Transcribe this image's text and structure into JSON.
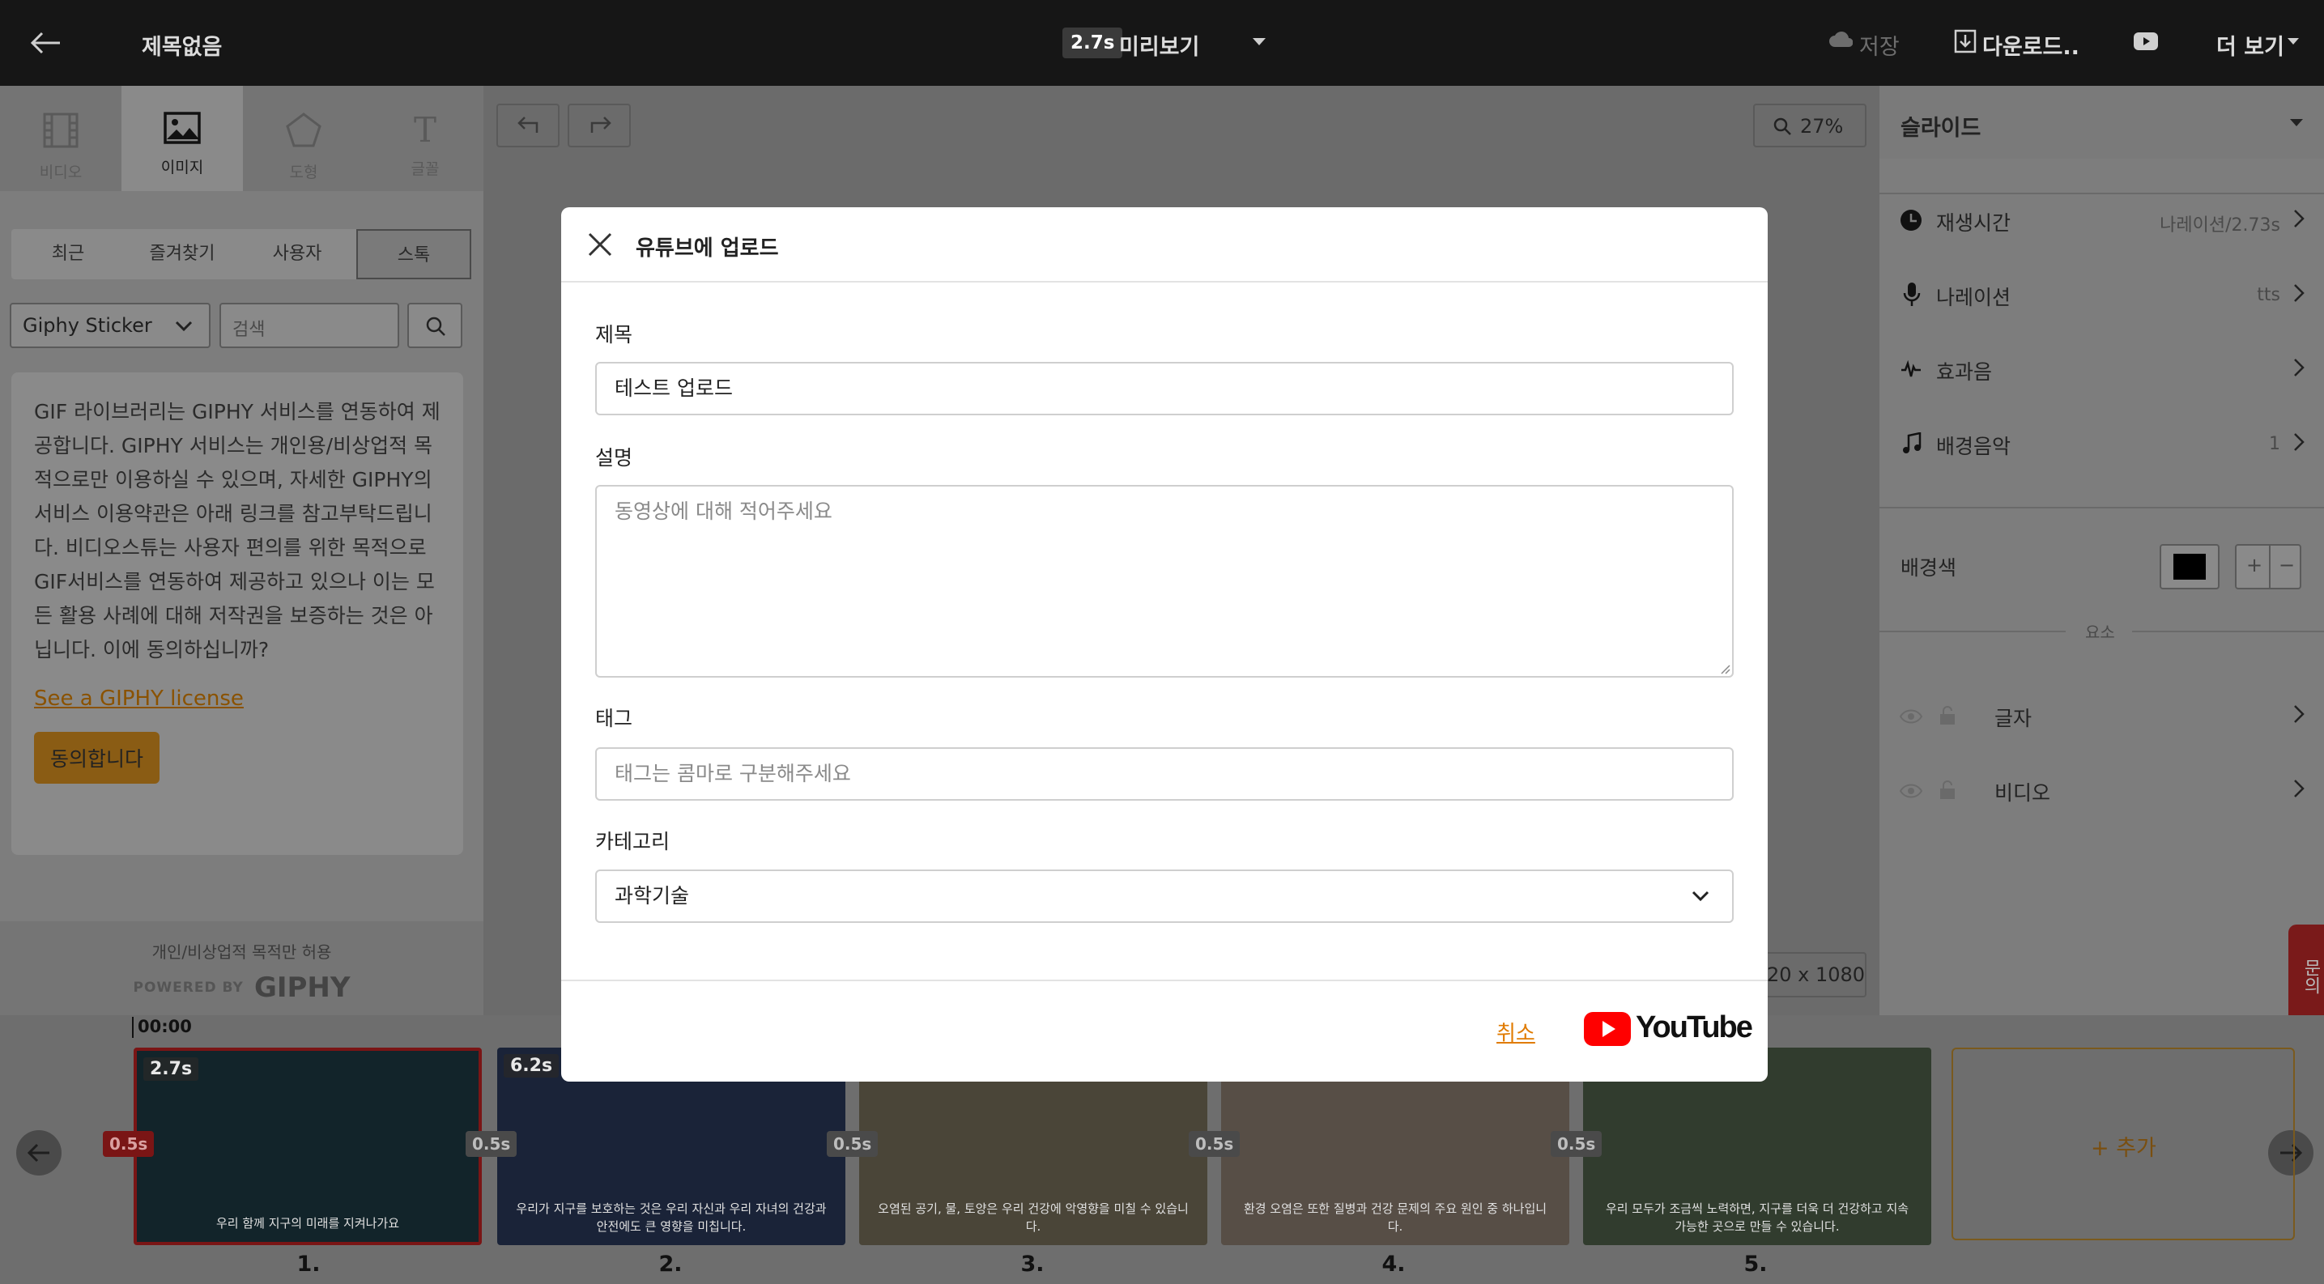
{
  "topbar": {
    "title": "제목없음",
    "duration": "2.7s",
    "preview": "미리보기",
    "save": "저장",
    "download": "다운로드..",
    "more": "더 보기"
  },
  "left": {
    "tools": [
      "비디오",
      "이미지",
      "도형",
      "글꼴"
    ],
    "tool_icons": [
      "film-icon",
      "image-icon",
      "pentagon-icon",
      "text-icon"
    ],
    "subtabs": [
      "최근",
      "즐겨찾기",
      "사용자",
      "스톡"
    ],
    "source_select": "Giphy Sticker",
    "search_placeholder": "검색",
    "notice": "GIF 라이브러리는 GIPHY 서비스를 연동하여 제공합니다. GIPHY 서비스는 개인용/비상업적 목적으로만 이용하실 수 있으며, 자세한 GIPHY의 서비스 이용약관은 아래 링크를 참고부탁드립니다. 비디오스튜는 사용자 편의를 위한 목적으로 GIF서비스를 연동하여 제공하고 있으나 이는 모든 활용 사례에 대해 저작권을 보증하는 것은 아닙니다. 이에 동의하십니까?",
    "license_link": "See a GIPHY license",
    "agree_button": "동의합니다",
    "footer_note": "개인/비상업적 목적만 허용",
    "powered_by": "POWERED BY",
    "giphy_logo": "GIPHY"
  },
  "canvas": {
    "zoom": "27%",
    "resolution": "20 x 1080"
  },
  "right": {
    "section_title": "슬라이드",
    "rows": [
      {
        "label": "재생시간",
        "value": "나레이션/2.73s",
        "icon": "clock-icon"
      },
      {
        "label": "나레이션",
        "value": "tts",
        "icon": "microphone-icon"
      },
      {
        "label": "효과음",
        "value": "",
        "icon": "sound-effect-icon"
      },
      {
        "label": "배경음악",
        "value": "1",
        "icon": "music-note-icon"
      }
    ],
    "bg_color_label": "배경색",
    "bg_color": "#000000",
    "elements_label": "요소",
    "elements": [
      "글자",
      "비디오"
    ],
    "inquiry_tab": "문의"
  },
  "modal": {
    "title": "유튜브에 업로드",
    "fields": {
      "title_label": "제목",
      "title_value": "테스트 업로드",
      "desc_label": "설명",
      "desc_placeholder": "동영상에 대해 적어주세요",
      "tags_label": "태그",
      "tags_placeholder": "태그는 콤마로 구분해주세요",
      "category_label": "카테고리",
      "category_value": "과학기술"
    },
    "cancel": "취소",
    "youtube": "YouTube"
  },
  "timeline": {
    "playhead": "00:00",
    "add": "추가",
    "transition": "0.5s",
    "clips": [
      {
        "num": "1.",
        "dur": "2.7s",
        "caption": "우리 함께 지구의 미래를 지켜나가요",
        "bg": "#1d3a3a"
      },
      {
        "num": "2.",
        "dur": "6.2s",
        "caption": "우리가 지구를 보호하는 것은 우리 자신과 우리 자녀의 건강과 안전에도 큰 영향을 미칩니다.",
        "bg": "#2a3550"
      },
      {
        "num": "3.",
        "dur": "",
        "caption": "오염된 공기, 물, 토양은 우리 건강에 악영향을 미칠 수 있습니다.",
        "bg": "#5b5446"
      },
      {
        "num": "4.",
        "dur": "",
        "caption": "환경 오염은 또한 질병과 건강 문제의 주요 원인 중 하나입니다.",
        "bg": "#6a5f55"
      },
      {
        "num": "5.",
        "dur": "",
        "caption": "우리 모두가 조금씩 노력하면, 지구를 더욱 더 건강하고 지속 가능한 곳으로 만들 수 있습니다.",
        "bg": "#3f4d3a"
      }
    ]
  },
  "colors": {
    "accent": "#e07b00",
    "selected_clip": "#c81e1e",
    "youtube_red": "#ff0000"
  }
}
